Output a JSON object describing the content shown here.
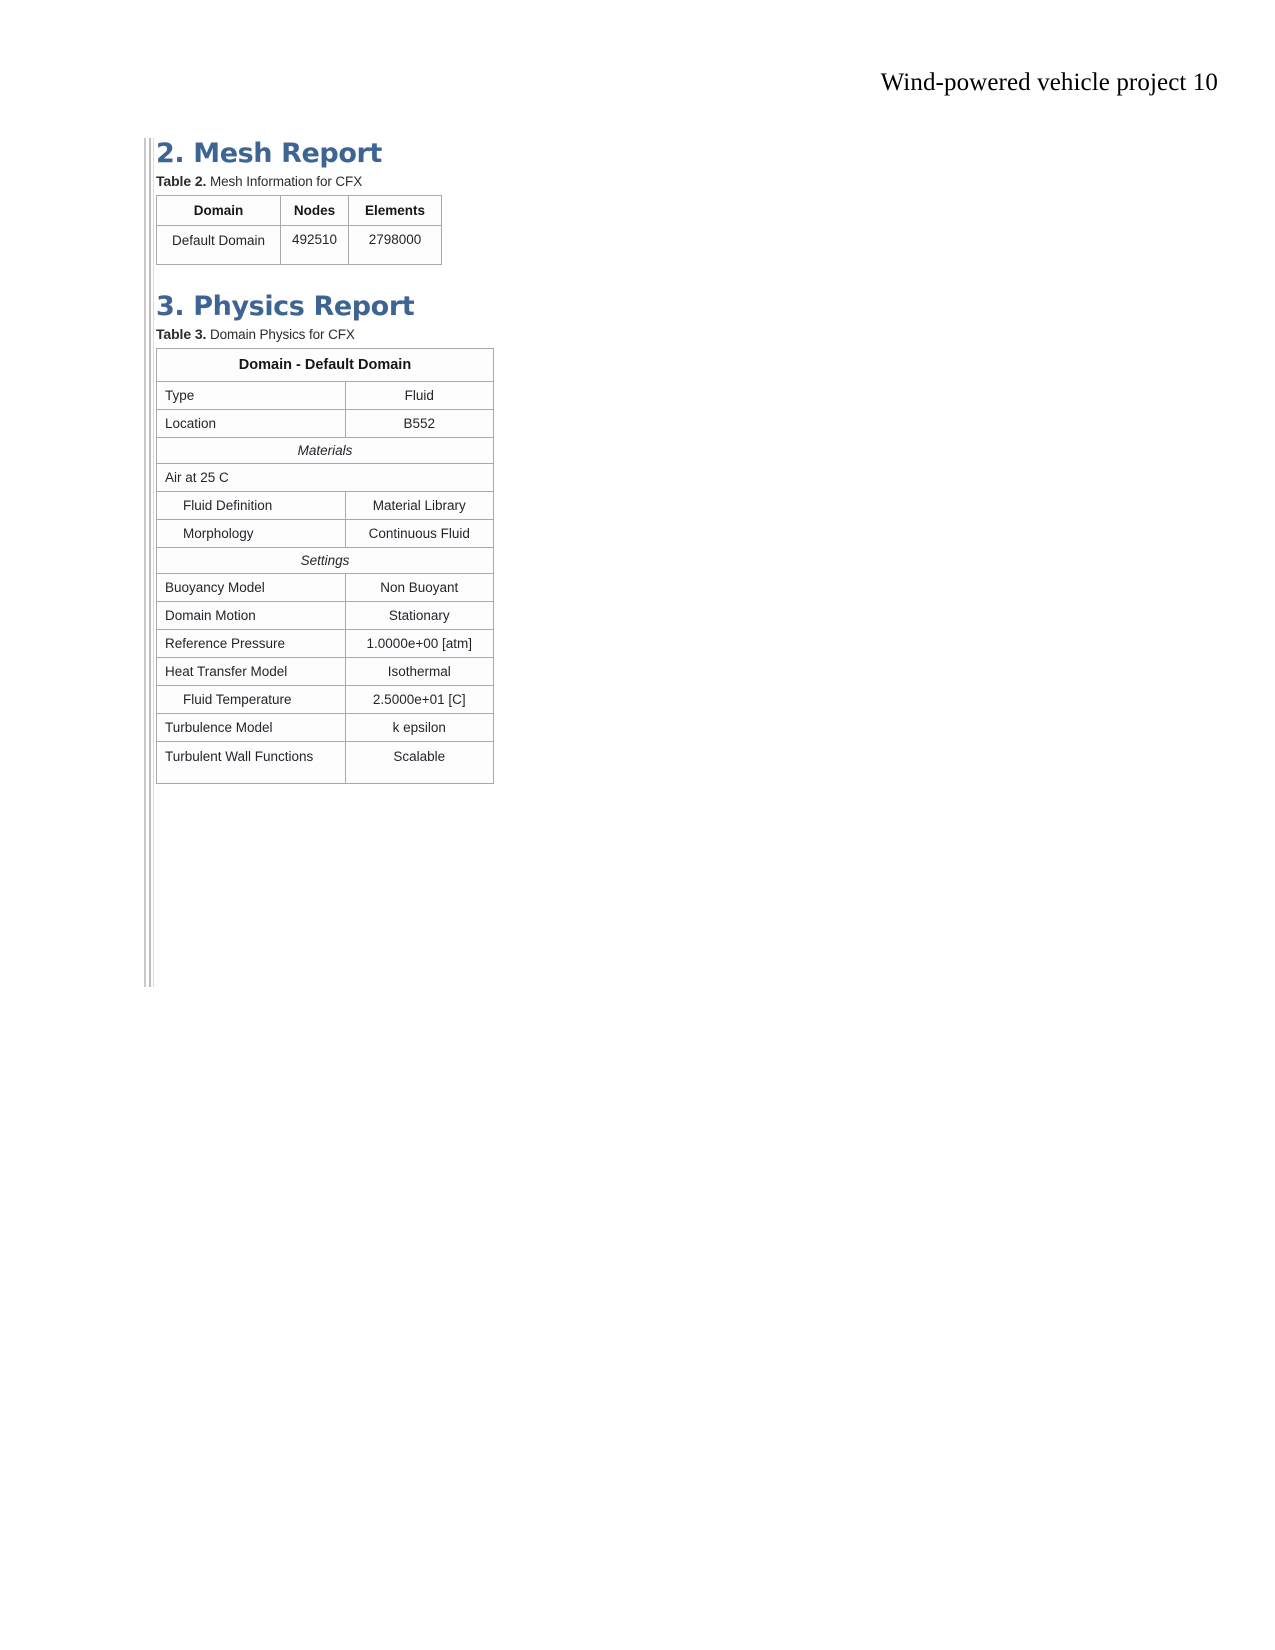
{
  "header": {
    "running_title": "Wind-powered vehicle project 10"
  },
  "sections": {
    "mesh": {
      "heading": "2. Mesh Report",
      "caption_label": "Table 2.",
      "caption_text": "Mesh Information for CFX",
      "table": {
        "columns": [
          "Domain",
          "Nodes",
          "Elements"
        ],
        "rows": [
          [
            "Default Domain",
            "492510",
            "2798000"
          ]
        ]
      }
    },
    "physics": {
      "heading": "3. Physics Report",
      "caption_label": "Table 3.",
      "caption_text": "Domain Physics for CFX",
      "table": {
        "title": "Domain - Default Domain",
        "rows": [
          {
            "kind": "pair",
            "key": "Type",
            "value": "Fluid"
          },
          {
            "kind": "pair",
            "key": "Location",
            "value": "B552"
          },
          {
            "kind": "group",
            "key": "Materials",
            "value": ""
          },
          {
            "kind": "full",
            "key": "Air at 25 C",
            "value": ""
          },
          {
            "kind": "pair",
            "key": "Fluid Definition",
            "value": "Material Library",
            "indent": true
          },
          {
            "kind": "pair",
            "key": "Morphology",
            "value": "Continuous Fluid",
            "indent": true
          },
          {
            "kind": "group",
            "key": "Settings",
            "value": ""
          },
          {
            "kind": "pair",
            "key": "Buoyancy Model",
            "value": "Non Buoyant"
          },
          {
            "kind": "pair",
            "key": "Domain Motion",
            "value": "Stationary"
          },
          {
            "kind": "pair",
            "key": "Reference Pressure",
            "value": "1.0000e+00 [atm]"
          },
          {
            "kind": "pair",
            "key": "Heat Transfer Model",
            "value": "Isothermal"
          },
          {
            "kind": "pair",
            "key": "Fluid Temperature",
            "value": "2.5000e+01 [C]",
            "indent": true
          },
          {
            "kind": "pair",
            "key": "Turbulence Model",
            "value": "k epsilon"
          },
          {
            "kind": "pair",
            "key": "Turbulent Wall Functions",
            "value": "Scalable",
            "tall": true
          }
        ]
      }
    }
  },
  "colors": {
    "heading_blue": "#3e6493",
    "table_border": "#a9a9a9",
    "page_background": "#ffffff",
    "text": "#22252b"
  }
}
